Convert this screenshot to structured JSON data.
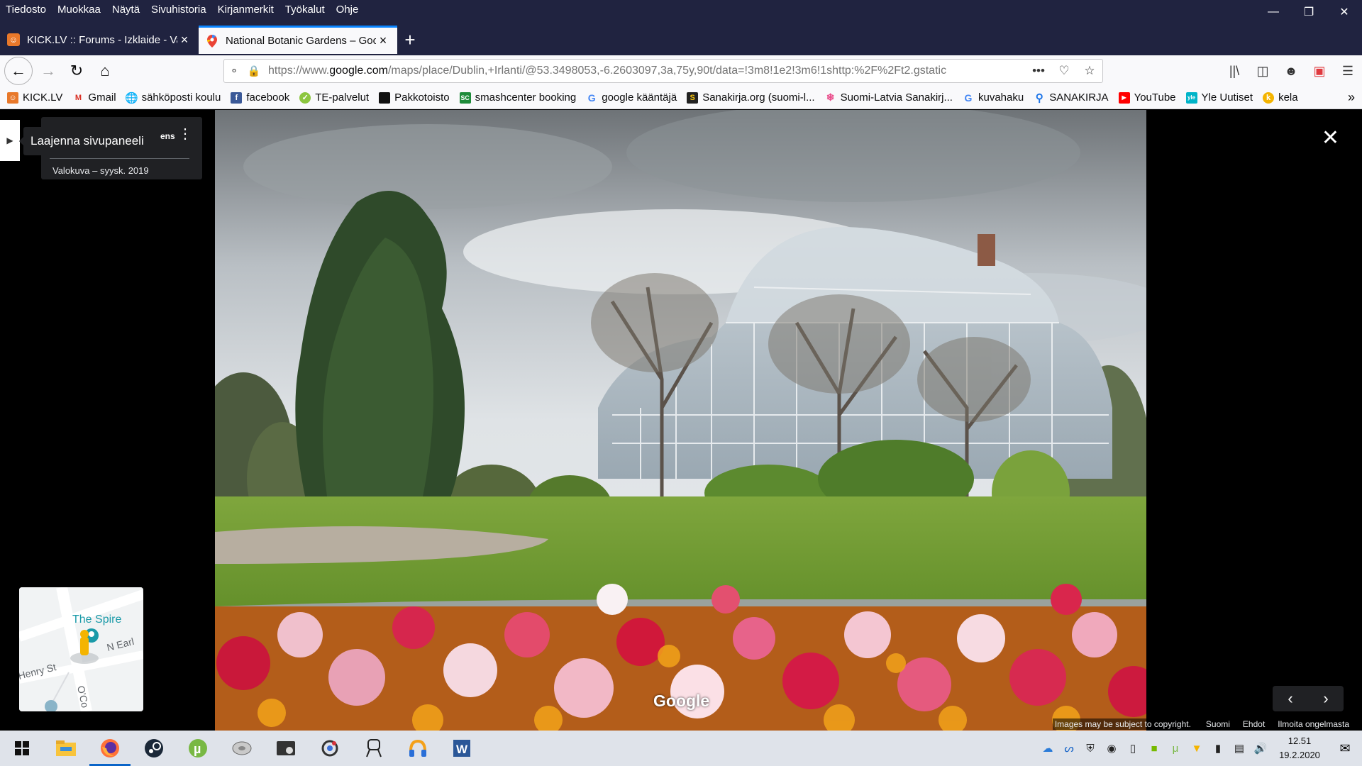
{
  "menubar": {
    "items": [
      "Tiedosto",
      "Muokkaa",
      "Näytä",
      "Sivuhistoria",
      "Kirjanmerkit",
      "Työkalut",
      "Ohje"
    ]
  },
  "tabs": [
    {
      "title": "KICK.LV :: Forums - Izklaide - Va",
      "active": false
    },
    {
      "title": "National Botanic Gardens – Goo",
      "active": true
    }
  ],
  "navbar": {
    "url_prefix": "https://www.",
    "url_domain": "google.com",
    "url_rest": "/maps/place/Dublin,+Irlanti/@53.3498053,-6.2603097,3a,75y,90t/data=!3m8!1e2!3m6!1shttp:%2F%2Ft2.gstatic"
  },
  "bookmarks": [
    {
      "label": "KICK.LV",
      "icon": "kick-icon",
      "color": "#e8782a"
    },
    {
      "label": "Gmail",
      "icon": "gmail-icon",
      "color": "#d93025"
    },
    {
      "label": "sähköposti koulu",
      "icon": "globe-icon",
      "color": "#555555"
    },
    {
      "label": "facebook",
      "icon": "facebook-icon",
      "color": "#3b5998"
    },
    {
      "label": "TE-palvelut",
      "icon": "te-icon",
      "color": "#8cc63f"
    },
    {
      "label": "Pakkotoisto",
      "icon": "pakkotoisto-icon",
      "color": "#111111"
    },
    {
      "label": "smashcenter booking",
      "icon": "smashcenter-icon",
      "color": "#1e8b3a"
    },
    {
      "label": "google kääntäjä",
      "icon": "google-icon",
      "color": "#4285f4"
    },
    {
      "label": "Sanakirja.org (suomi-l...",
      "icon": "sanakirja-icon",
      "color": "#222222"
    },
    {
      "label": "Suomi-Latvia Sanakirj...",
      "icon": "puzzle-icon",
      "color": "#e94b8a"
    },
    {
      "label": "kuvahaku",
      "icon": "google-icon",
      "color": "#4285f4"
    },
    {
      "label": "SANAKIRJA",
      "icon": "search-icon",
      "color": "#1a73e8"
    },
    {
      "label": "YouTube",
      "icon": "youtube-icon",
      "color": "#ff0000"
    },
    {
      "label": "Yle Uutiset",
      "icon": "yle-icon",
      "color": "#00b4c8"
    },
    {
      "label": "kela",
      "icon": "kela-icon",
      "color": "#f4b400"
    }
  ],
  "viewer": {
    "tooltip": "Laajenna sivupaneeli",
    "place_name_fragment": "ens",
    "photo_date": "Valokuva – syysk. 2019",
    "watermark": "Google",
    "footer": {
      "copyright": "Images may be subject to copyright.",
      "language": "Suomi",
      "terms": "Ehdot",
      "report": "Ilmoita ongelmasta"
    }
  },
  "minimap": {
    "labels": {
      "spire": "The Spire",
      "street1": "N Earl",
      "street2": "Henry St",
      "street3": "O'Co"
    }
  },
  "taskbar": {
    "time": "12.51",
    "date": "19.2.2020"
  }
}
